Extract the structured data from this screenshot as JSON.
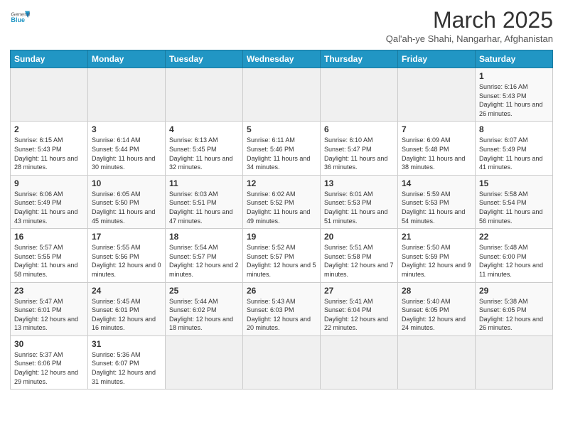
{
  "header": {
    "logo_general": "General",
    "logo_blue": "Blue",
    "title": "March 2025",
    "subtitle": "Qal'ah-ye Shahi, Nangarhar, Afghanistan"
  },
  "weekdays": [
    "Sunday",
    "Monday",
    "Tuesday",
    "Wednesday",
    "Thursday",
    "Friday",
    "Saturday"
  ],
  "weeks": [
    [
      {
        "day": "",
        "info": ""
      },
      {
        "day": "",
        "info": ""
      },
      {
        "day": "",
        "info": ""
      },
      {
        "day": "",
        "info": ""
      },
      {
        "day": "",
        "info": ""
      },
      {
        "day": "",
        "info": ""
      },
      {
        "day": "1",
        "info": "Sunrise: 6:16 AM\nSunset: 5:43 PM\nDaylight: 11 hours and 26 minutes."
      }
    ],
    [
      {
        "day": "2",
        "info": "Sunrise: 6:15 AM\nSunset: 5:43 PM\nDaylight: 11 hours and 28 minutes."
      },
      {
        "day": "3",
        "info": "Sunrise: 6:14 AM\nSunset: 5:44 PM\nDaylight: 11 hours and 30 minutes."
      },
      {
        "day": "4",
        "info": "Sunrise: 6:13 AM\nSunset: 5:45 PM\nDaylight: 11 hours and 32 minutes."
      },
      {
        "day": "5",
        "info": "Sunrise: 6:11 AM\nSunset: 5:46 PM\nDaylight: 11 hours and 34 minutes."
      },
      {
        "day": "6",
        "info": "Sunrise: 6:10 AM\nSunset: 5:47 PM\nDaylight: 11 hours and 36 minutes."
      },
      {
        "day": "7",
        "info": "Sunrise: 6:09 AM\nSunset: 5:48 PM\nDaylight: 11 hours and 38 minutes."
      },
      {
        "day": "8",
        "info": "Sunrise: 6:07 AM\nSunset: 5:49 PM\nDaylight: 11 hours and 41 minutes."
      }
    ],
    [
      {
        "day": "9",
        "info": "Sunrise: 6:06 AM\nSunset: 5:49 PM\nDaylight: 11 hours and 43 minutes."
      },
      {
        "day": "10",
        "info": "Sunrise: 6:05 AM\nSunset: 5:50 PM\nDaylight: 11 hours and 45 minutes."
      },
      {
        "day": "11",
        "info": "Sunrise: 6:03 AM\nSunset: 5:51 PM\nDaylight: 11 hours and 47 minutes."
      },
      {
        "day": "12",
        "info": "Sunrise: 6:02 AM\nSunset: 5:52 PM\nDaylight: 11 hours and 49 minutes."
      },
      {
        "day": "13",
        "info": "Sunrise: 6:01 AM\nSunset: 5:53 PM\nDaylight: 11 hours and 51 minutes."
      },
      {
        "day": "14",
        "info": "Sunrise: 5:59 AM\nSunset: 5:53 PM\nDaylight: 11 hours and 54 minutes."
      },
      {
        "day": "15",
        "info": "Sunrise: 5:58 AM\nSunset: 5:54 PM\nDaylight: 11 hours and 56 minutes."
      }
    ],
    [
      {
        "day": "16",
        "info": "Sunrise: 5:57 AM\nSunset: 5:55 PM\nDaylight: 11 hours and 58 minutes."
      },
      {
        "day": "17",
        "info": "Sunrise: 5:55 AM\nSunset: 5:56 PM\nDaylight: 12 hours and 0 minutes."
      },
      {
        "day": "18",
        "info": "Sunrise: 5:54 AM\nSunset: 5:57 PM\nDaylight: 12 hours and 2 minutes."
      },
      {
        "day": "19",
        "info": "Sunrise: 5:52 AM\nSunset: 5:57 PM\nDaylight: 12 hours and 5 minutes."
      },
      {
        "day": "20",
        "info": "Sunrise: 5:51 AM\nSunset: 5:58 PM\nDaylight: 12 hours and 7 minutes."
      },
      {
        "day": "21",
        "info": "Sunrise: 5:50 AM\nSunset: 5:59 PM\nDaylight: 12 hours and 9 minutes."
      },
      {
        "day": "22",
        "info": "Sunrise: 5:48 AM\nSunset: 6:00 PM\nDaylight: 12 hours and 11 minutes."
      }
    ],
    [
      {
        "day": "23",
        "info": "Sunrise: 5:47 AM\nSunset: 6:01 PM\nDaylight: 12 hours and 13 minutes."
      },
      {
        "day": "24",
        "info": "Sunrise: 5:45 AM\nSunset: 6:01 PM\nDaylight: 12 hours and 16 minutes."
      },
      {
        "day": "25",
        "info": "Sunrise: 5:44 AM\nSunset: 6:02 PM\nDaylight: 12 hours and 18 minutes."
      },
      {
        "day": "26",
        "info": "Sunrise: 5:43 AM\nSunset: 6:03 PM\nDaylight: 12 hours and 20 minutes."
      },
      {
        "day": "27",
        "info": "Sunrise: 5:41 AM\nSunset: 6:04 PM\nDaylight: 12 hours and 22 minutes."
      },
      {
        "day": "28",
        "info": "Sunrise: 5:40 AM\nSunset: 6:05 PM\nDaylight: 12 hours and 24 minutes."
      },
      {
        "day": "29",
        "info": "Sunrise: 5:38 AM\nSunset: 6:05 PM\nDaylight: 12 hours and 26 minutes."
      }
    ],
    [
      {
        "day": "30",
        "info": "Sunrise: 5:37 AM\nSunset: 6:06 PM\nDaylight: 12 hours and 29 minutes."
      },
      {
        "day": "31",
        "info": "Sunrise: 5:36 AM\nSunset: 6:07 PM\nDaylight: 12 hours and 31 minutes."
      },
      {
        "day": "",
        "info": ""
      },
      {
        "day": "",
        "info": ""
      },
      {
        "day": "",
        "info": ""
      },
      {
        "day": "",
        "info": ""
      },
      {
        "day": "",
        "info": ""
      }
    ]
  ]
}
